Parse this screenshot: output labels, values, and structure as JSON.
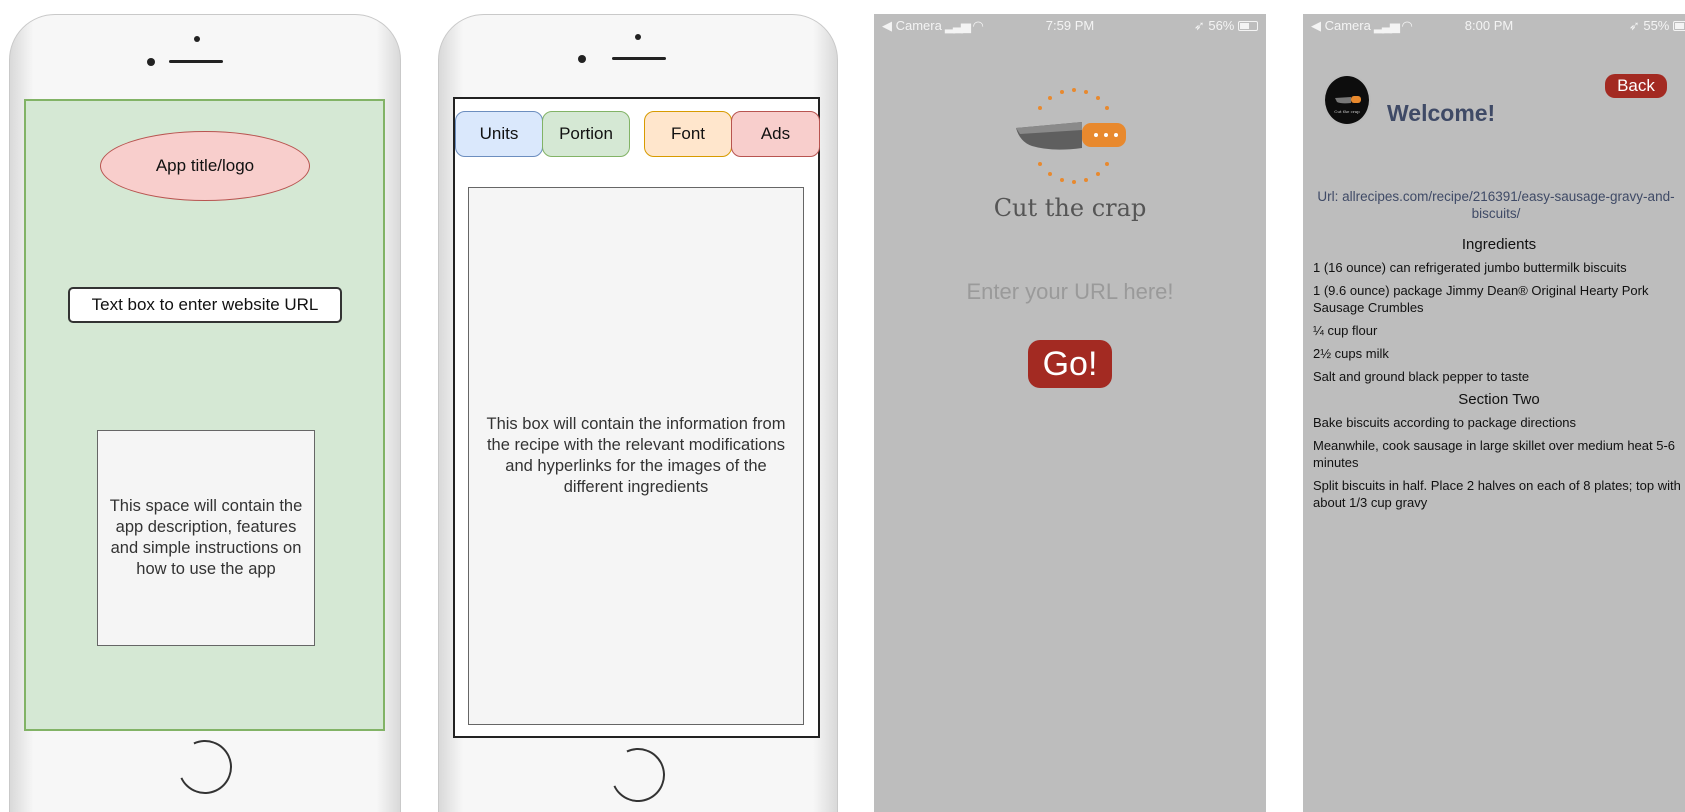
{
  "mockup1": {
    "logo_label": "App title/logo",
    "url_box_label": "Text box to enter website URL",
    "description_text": "This space will contain the app description, features and simple instructions on how to use the app"
  },
  "mockup2": {
    "tabs": [
      "Units",
      "Portion",
      "Font",
      "Ads"
    ],
    "recipe_box_text": "This box will contain the information from the recipe with the relevant modifications and hyperlinks for the images of the different ingredients"
  },
  "screen3": {
    "status": {
      "back_app": "◀ Camera",
      "time": "7:59 PM",
      "battery": "56%"
    },
    "app_name": "Cut the crap",
    "url_placeholder": "Enter your URL here!",
    "go_label": "Go!"
  },
  "screen4": {
    "status": {
      "back_app": "◀ Camera",
      "time": "8:00 PM",
      "battery": "55%"
    },
    "back_label": "Back",
    "welcome": "Welcome!",
    "url_text": "Url: allrecipes.com/recipe/216391/easy-sausage-gravy-and-biscuits/",
    "ingredients_heading": "Ingredients",
    "ingredients": [
      "1 (16 ounce) can refrigerated jumbo buttermilk biscuits",
      "1 (9.6 ounce) package Jimmy Dean® Original Hearty Pork Sausage Crumbles",
      "¼ cup flour",
      "2½ cups milk",
      "Salt and ground black pepper to taste"
    ],
    "section_heading": "Section Two",
    "steps": [
      "Bake biscuits according to package directions",
      "Meanwhile, cook sausage in large skillet over medium heat 5-6 minutes",
      "Split biscuits in half. Place 2 halves on each of 8 plates; top with about 1/3 cup gravy"
    ]
  }
}
